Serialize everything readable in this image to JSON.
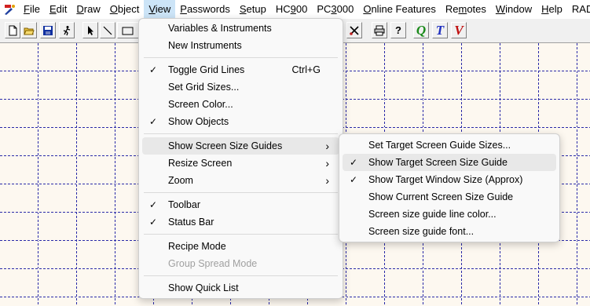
{
  "menubar": {
    "items": [
      {
        "label": "File",
        "mn": "F",
        "rest": "ile"
      },
      {
        "label": "Edit",
        "mn": "E",
        "rest": "dit"
      },
      {
        "label": "Draw",
        "mn": "D",
        "rest": "raw"
      },
      {
        "label": "Object",
        "mn": "O",
        "rest": "bject"
      },
      {
        "label": "View",
        "mn": "V",
        "rest": "iew"
      },
      {
        "label": "Passwords",
        "mn": "P",
        "rest": "asswords"
      },
      {
        "label": "Setup",
        "mn": "S",
        "rest": "etup"
      },
      {
        "label": "HC900",
        "pre": "HC",
        "mn": "9",
        "rest": "00"
      },
      {
        "label": "PC3000",
        "pre": "PC",
        "mn": "3",
        "rest": "000"
      },
      {
        "label": "Online Features",
        "mn": "O",
        "rest": "nline Features"
      },
      {
        "label": "Remotes",
        "pre": "Re",
        "mn": "m",
        "rest": "otes"
      },
      {
        "label": "Window",
        "mn": "W",
        "rest": "indow"
      },
      {
        "label": "Help",
        "mn": "H",
        "rest": "elp"
      },
      {
        "label": "RAD",
        "pre": "",
        "mn": "",
        "rest": "RAD"
      }
    ]
  },
  "toolbar": {
    "icons": [
      "new-file-icon",
      "open-folder-icon",
      "save-disk-icon",
      "run-figure-icon",
      "select-arrow-icon",
      "line-tool-icon",
      "rectangle-tool-icon"
    ],
    "right_icons": [
      "scissors-tools-icon",
      "print-icon",
      "help-question-icon",
      "q-icon",
      "t-icon",
      "v-icon"
    ],
    "q_label": "Q",
    "t_label": "T",
    "v_label": "V",
    "help_label": "?"
  },
  "colors": {
    "grid_line": "#2a2aa8",
    "canvas_bg": "#fdf8f0",
    "menu_bg": "#f9f9f9",
    "highlight": "#e8e8e8",
    "q_color": "#1a8a1a",
    "t_color": "#2030c0",
    "v_color": "#c01010"
  },
  "view_menu": {
    "items": [
      {
        "label": "Variables & Instruments",
        "checked": false,
        "shortcut": "",
        "submenu": false
      },
      {
        "label": "New Instruments",
        "checked": false,
        "shortcut": "",
        "submenu": false
      },
      {
        "label": "Toggle Grid Lines",
        "checked": true,
        "shortcut": "Ctrl+G",
        "submenu": false
      },
      {
        "label": "Set Grid Sizes...",
        "checked": false,
        "shortcut": "",
        "submenu": false
      },
      {
        "label": "Screen Color...",
        "checked": false,
        "shortcut": "",
        "submenu": false
      },
      {
        "label": "Show Objects",
        "checked": true,
        "shortcut": "",
        "submenu": false
      },
      {
        "label": "Show Screen Size Guides",
        "checked": false,
        "shortcut": "",
        "submenu": true
      },
      {
        "label": "Resize Screen",
        "checked": false,
        "shortcut": "",
        "submenu": true
      },
      {
        "label": "Zoom",
        "checked": false,
        "shortcut": "",
        "submenu": true
      },
      {
        "label": "Toolbar",
        "checked": true,
        "shortcut": "",
        "submenu": false
      },
      {
        "label": "Status Bar",
        "checked": true,
        "shortcut": "",
        "submenu": false
      },
      {
        "label": "Recipe Mode",
        "checked": false,
        "shortcut": "",
        "submenu": false
      },
      {
        "label": "Group Spread Mode",
        "checked": false,
        "shortcut": "",
        "submenu": false,
        "disabled": true
      },
      {
        "label": "Show Quick List",
        "checked": false,
        "shortcut": "",
        "submenu": false
      }
    ]
  },
  "guides_submenu": {
    "items": [
      {
        "label": "Set Target Screen Guide Sizes...",
        "checked": false
      },
      {
        "label": "Show Target Screen Size Guide",
        "checked": true
      },
      {
        "label": "Show Target Window Size (Approx)",
        "checked": true
      },
      {
        "label": "Show Current Screen Size Guide",
        "checked": false
      },
      {
        "label": "Screen size guide line color...",
        "checked": false
      },
      {
        "label": "Screen size guide font...",
        "checked": false
      }
    ]
  },
  "glyphs": {
    "check": "✓",
    "arrow": "›"
  }
}
